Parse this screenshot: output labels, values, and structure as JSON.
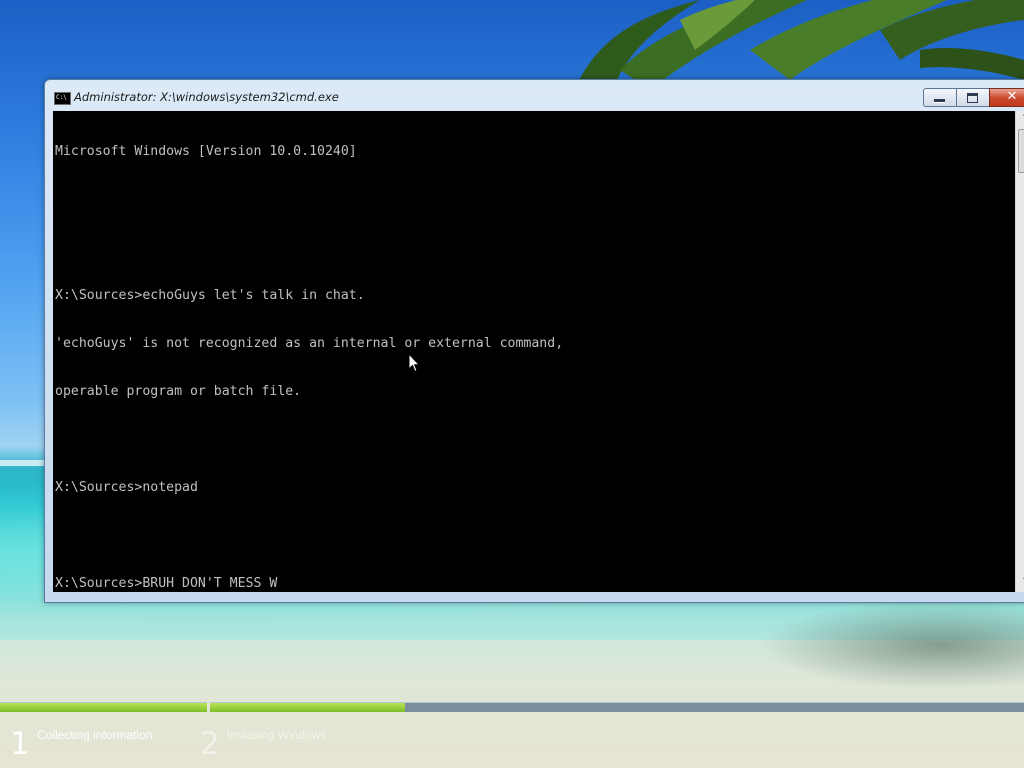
{
  "window": {
    "title": "Administrator: X:\\windows\\system32\\cmd.exe",
    "icon_text": "C:\\",
    "buttons": {
      "minimize": "minimize",
      "maximize": "maximize",
      "close": "✕"
    }
  },
  "console": {
    "lines": [
      "Microsoft Windows [Version 10.0.10240]",
      "",
      "",
      "X:\\Sources>echoGuys let's talk in chat.",
      "'echoGuys' is not recognized as an internal or external command,",
      "operable program or batch file.",
      "",
      "X:\\Sources>notepad",
      "",
      "X:\\Sources>BRUH DON'T MESS W"
    ],
    "foreground": "#c0c0c0",
    "background": "#000000"
  },
  "scrollbar": {
    "up_glyph": "˄",
    "down_glyph": "˅"
  },
  "setup": {
    "steps": [
      {
        "number": "1",
        "label": "Collecting information",
        "progress": 1.0
      },
      {
        "number": "2",
        "label": "Installing Windows",
        "progress": 0.24
      }
    ],
    "accent": "#8cc63f"
  },
  "icons": {
    "mouse": "arrow-cursor-icon",
    "window": "cmd-icon"
  }
}
